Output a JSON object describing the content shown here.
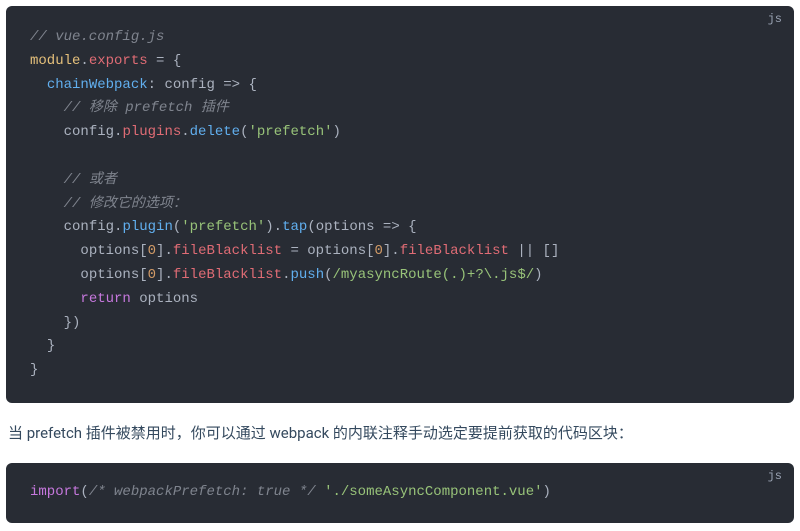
{
  "block1": {
    "lang": "js",
    "lines": {
      "l1": "// vue.config.js",
      "l2a": "module",
      "l2b": ".",
      "l2c": "exports",
      "l2d": " = {",
      "l3a": "chainWebpack",
      "l3b": ": ",
      "l3c": "config",
      "l3d": " => {",
      "l4": "// 移除 prefetch 插件",
      "l5a": "config",
      "l5b": ".",
      "l5c": "plugins",
      "l5d": ".",
      "l5e": "delete",
      "l5f": "(",
      "l5g": "'prefetch'",
      "l5h": ")",
      "l6": "// 或者",
      "l7": "// 修改它的选项：",
      "l8a": "config",
      "l8b": ".",
      "l8c": "plugin",
      "l8d": "(",
      "l8e": "'prefetch'",
      "l8f": ").",
      "l8g": "tap",
      "l8h": "(",
      "l8i": "options",
      "l8j": " => {",
      "l9a": "options[",
      "l9b": "0",
      "l9c": "].",
      "l9d": "fileBlacklist",
      "l9e": " = options[",
      "l9f": "0",
      "l9g": "].",
      "l9h": "fileBlacklist",
      "l9i": " || []",
      "l10a": "options[",
      "l10b": "0",
      "l10c": "].",
      "l10d": "fileBlacklist",
      "l10e": ".",
      "l10f": "push",
      "l10g": "(",
      "l10h": "/myasyncRoute(.)+?\\.js$/",
      "l10i": ")",
      "l11a": "return",
      "l11b": " options",
      "l12": "})",
      "l13": "}",
      "l14": "}"
    }
  },
  "prose1": "当 prefetch 插件被禁用时，你可以通过 webpack 的内联注释手动选定要提前获取的代码区块：",
  "block2": {
    "lang": "js",
    "lines": {
      "l1a": "import",
      "l1b": "(",
      "l1c": "/* webpackPrefetch: true */",
      "l1d": " ",
      "l1e": "'./someAsyncComponent.vue'",
      "l1f": ")"
    }
  }
}
